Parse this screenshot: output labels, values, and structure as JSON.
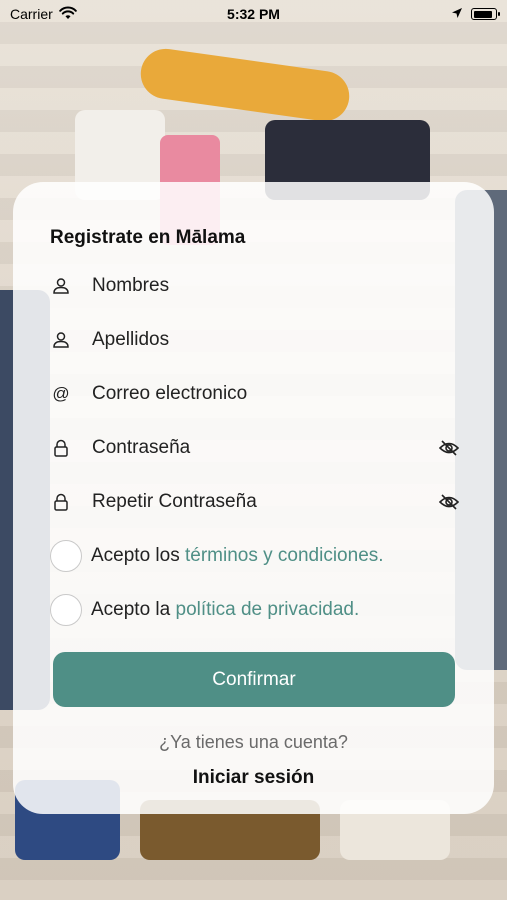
{
  "status_bar": {
    "carrier": "Carrier",
    "time": "5:32 PM",
    "icons": [
      "wifi-icon",
      "location-arrow-icon",
      "battery-icon"
    ],
    "battery_level": 0.9
  },
  "form": {
    "title": "Registrate en Mālama",
    "fields": [
      {
        "icon": "person-icon",
        "label": "Nombres"
      },
      {
        "icon": "person-icon",
        "label": "Apellidos"
      },
      {
        "icon": "at-icon",
        "label": "Correo electronico"
      },
      {
        "icon": "lock-icon",
        "label": "Contraseña",
        "toggle_icon": "eye-slash-icon"
      },
      {
        "icon": "lock-icon",
        "label": "Repetir Contraseña",
        "toggle_icon": "eye-slash-icon"
      }
    ],
    "terms": {
      "prefix": "Acepto los ",
      "link": "términos y condiciones."
    },
    "privacy": {
      "prefix": "Acepto la ",
      "link": "política de privacidad."
    },
    "confirm_label": "Confirmar",
    "already_text": "¿Ya tienes una cuenta?",
    "login_label": "Iniciar sesión"
  },
  "colors": {
    "accent": "#4f8f86",
    "card_bg": "#ffffff"
  }
}
